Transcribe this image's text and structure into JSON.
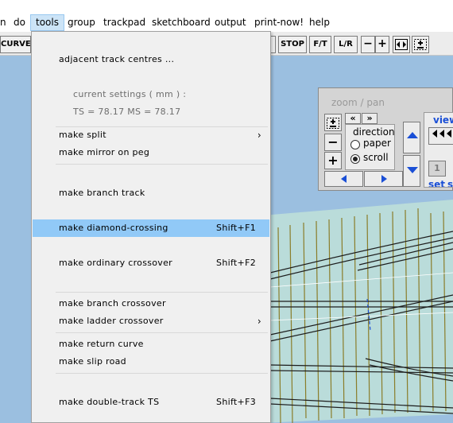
{
  "menubar": {
    "items": [
      "n",
      "do",
      "tools",
      "group",
      "trackpad",
      "sketchboard",
      "output",
      "print-now!",
      "help"
    ]
  },
  "toolbar": {
    "curve_label": "CURVE",
    "stop_label": "STOP",
    "ft_label": "F/T",
    "lr_label": "L/R",
    "minus_label": "−",
    "plus_label": "+",
    "fit_label": "◄►"
  },
  "zoom_panel": {
    "title": "zoom  /  pan",
    "direction_label": "direction",
    "paper_label": "paper",
    "scroll_label": "scroll",
    "scroll_selected": true,
    "prev_label": "«",
    "next_label": "»",
    "minus_label": "−",
    "plus_label": "+",
    "view_label": "view",
    "view_number": "1",
    "set_label": "set",
    "set_partial": "s"
  },
  "dropdown": {
    "items": [
      {
        "label": "adjacent  track  centres ..."
      },
      {
        "label": "make  split",
        "submenu": true
      },
      {
        "label": "make  mirror  on  peg"
      },
      {
        "label": "make  branch  track"
      },
      {
        "label": "make  diamond-crossing",
        "shortcut": "Shift+F1",
        "highlighted": true
      },
      {
        "label": "make  ordinary  crossover",
        "shortcut": "Shift+F2"
      },
      {
        "label": "make  branch  crossover"
      },
      {
        "label": "make  ladder  crossover",
        "submenu": true
      },
      {
        "label": "make  return  curve"
      },
      {
        "label": "make  slip  road"
      },
      {
        "label": "make  double-track  TS",
        "shortcut": "Shift+F3"
      }
    ],
    "info": {
      "heading": "current  settings  ( mm ) :",
      "values": "TS = 78.17      MS = 78.17"
    },
    "submenu_arrow": "›"
  },
  "colors": {
    "canvas_bg": "#9bbfe0",
    "track_fill": "#bfe0d8",
    "sleeper": "#8a7d2a",
    "highlight": "#91c9f7",
    "arrow_blue": "#1a4fd6"
  }
}
